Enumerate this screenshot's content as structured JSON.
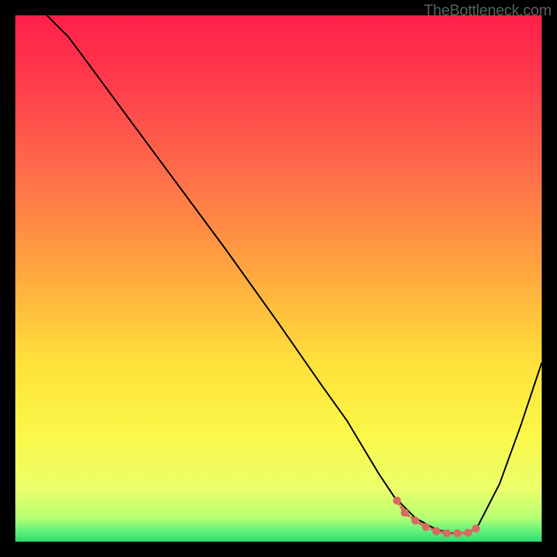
{
  "watermark": "TheBottleneck.com",
  "colors": {
    "gradient_stops": [
      {
        "offset": 0.0,
        "color": "#ff1f49"
      },
      {
        "offset": 0.12,
        "color": "#ff3a4c"
      },
      {
        "offset": 0.3,
        "color": "#ff6d4a"
      },
      {
        "offset": 0.48,
        "color": "#ffa43f"
      },
      {
        "offset": 0.66,
        "color": "#ffe13b"
      },
      {
        "offset": 0.8,
        "color": "#fbf84a"
      },
      {
        "offset": 0.9,
        "color": "#eaff6a"
      },
      {
        "offset": 0.955,
        "color": "#b6ff72"
      },
      {
        "offset": 0.975,
        "color": "#70f57a"
      },
      {
        "offset": 1.0,
        "color": "#2bdc6f"
      }
    ],
    "curve": "#000000",
    "marker": "#d96a63"
  },
  "chart_data": {
    "type": "line",
    "title": "",
    "xlabel": "",
    "ylabel": "",
    "xlim": [
      0,
      100
    ],
    "ylim": [
      0,
      100
    ],
    "grid": false,
    "series": [
      {
        "name": "curve",
        "x": [
          6,
          10,
          13,
          20,
          30,
          40,
          50,
          58,
          63,
          66,
          69,
          72,
          76,
          80,
          83,
          86,
          88,
          92,
          96,
          100
        ],
        "y": [
          100,
          96,
          92,
          82.5,
          69,
          55.5,
          41.5,
          30,
          23,
          18,
          13,
          8.5,
          4.5,
          2.3,
          1.6,
          1.6,
          3.2,
          11,
          22,
          34
        ]
      }
    ],
    "highlight": {
      "name": "bottom-band",
      "x": [
        72.5,
        74,
        76,
        78,
        80,
        82,
        84,
        86,
        87.5
      ],
      "y": [
        7.8,
        5.5,
        4.0,
        2.8,
        2.0,
        1.6,
        1.6,
        1.7,
        2.5
      ],
      "style": "markers+line",
      "color": "#d96a63"
    }
  }
}
